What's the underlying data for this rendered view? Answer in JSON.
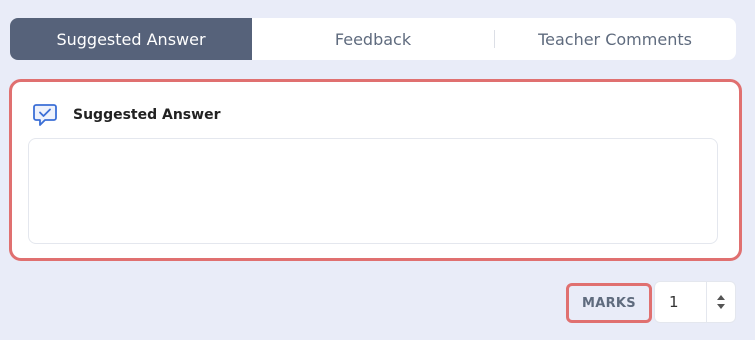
{
  "tabs": [
    {
      "label": "Suggested Answer",
      "active": true
    },
    {
      "label": "Feedback",
      "active": false
    },
    {
      "label": "Teacher Comments",
      "active": false
    }
  ],
  "answer_card": {
    "icon": "chat-check-icon",
    "title": "Suggested Answer",
    "content": ""
  },
  "marks": {
    "label": "MARKS",
    "value": "1"
  },
  "colors": {
    "active_tab": "#56627a",
    "highlight_border": "#e07070",
    "background": "#e9ecf8",
    "icon_accent": "#3b6fd6"
  }
}
